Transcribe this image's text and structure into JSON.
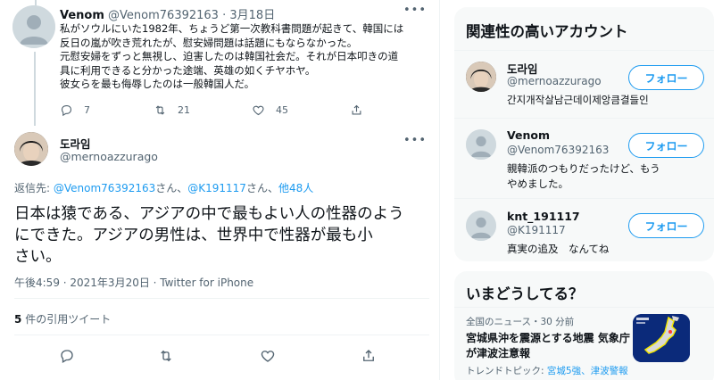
{
  "parent_tweet": {
    "name": "Venom",
    "handle": "@Venom76392163",
    "date": "3月18日",
    "lines": [
      "私がソウルにいた1982年、ちょうど第一次教科書問題が起きて、韓国には",
      "反日の嵐が吹き荒れたが、慰安婦問題は話題にもならなかった。",
      "元慰安婦をずっと無視し、迫害したのは韓国社会だ。それが日本叩きの道",
      "具に利用できると分かった途端、英雄の如くチヤホヤ。",
      "彼女らを最も侮辱したのは一般韓国人だ。"
    ],
    "reply_count": "7",
    "retweet_count": "21",
    "like_count": "45"
  },
  "focused_tweet": {
    "name": "도라임",
    "handle": "@mernoazzurago",
    "reply_to_label": "返信先:",
    "reply_to_user1": "@Venom76392163",
    "reply_to_sep1": "さん、",
    "reply_to_user2": "@K191117",
    "reply_to_sep2": "さん、",
    "reply_to_more": "他48人",
    "text_lines": [
      "日本は猿である、アジアの中で最もよい人の性器のよう",
      "にできた。アジアの男性は、世界中で性器が最も小",
      "さい。"
    ],
    "timestamp": "午後4:59 · 2021年3月20日 · Twitter for iPhone",
    "quote_count": "5",
    "quote_label": "件の引用ツイート"
  },
  "sidebar": {
    "related_title": "関連性の高いアカウント",
    "accounts": [
      {
        "name": "도라임",
        "handle": "@mernoazzurago",
        "bio": "간지개작살남근데이제앙큼결들인",
        "follow": "フォロー"
      },
      {
        "name": "Venom",
        "handle": "@Venom76392163",
        "bio": "親韓派のつもりだったけど、もうやめました。",
        "follow": "フォロー"
      },
      {
        "name": "knt_191117",
        "handle": "@K191117",
        "bio": "真実の追及　なんてね",
        "follow": "フォロー"
      }
    ],
    "trending_title": "いまどうしてる？",
    "trend": {
      "meta": "全国のニュース・30 分前",
      "title": "宮城県沖を震源とする地震 気象庁が津波注意報",
      "topic_label": "トレンドトピック:",
      "topic_links": "宮城5強、津波警報"
    }
  },
  "colors": {
    "accent": "#1d9bf0",
    "text": "#0f1419",
    "muted": "#536471"
  }
}
